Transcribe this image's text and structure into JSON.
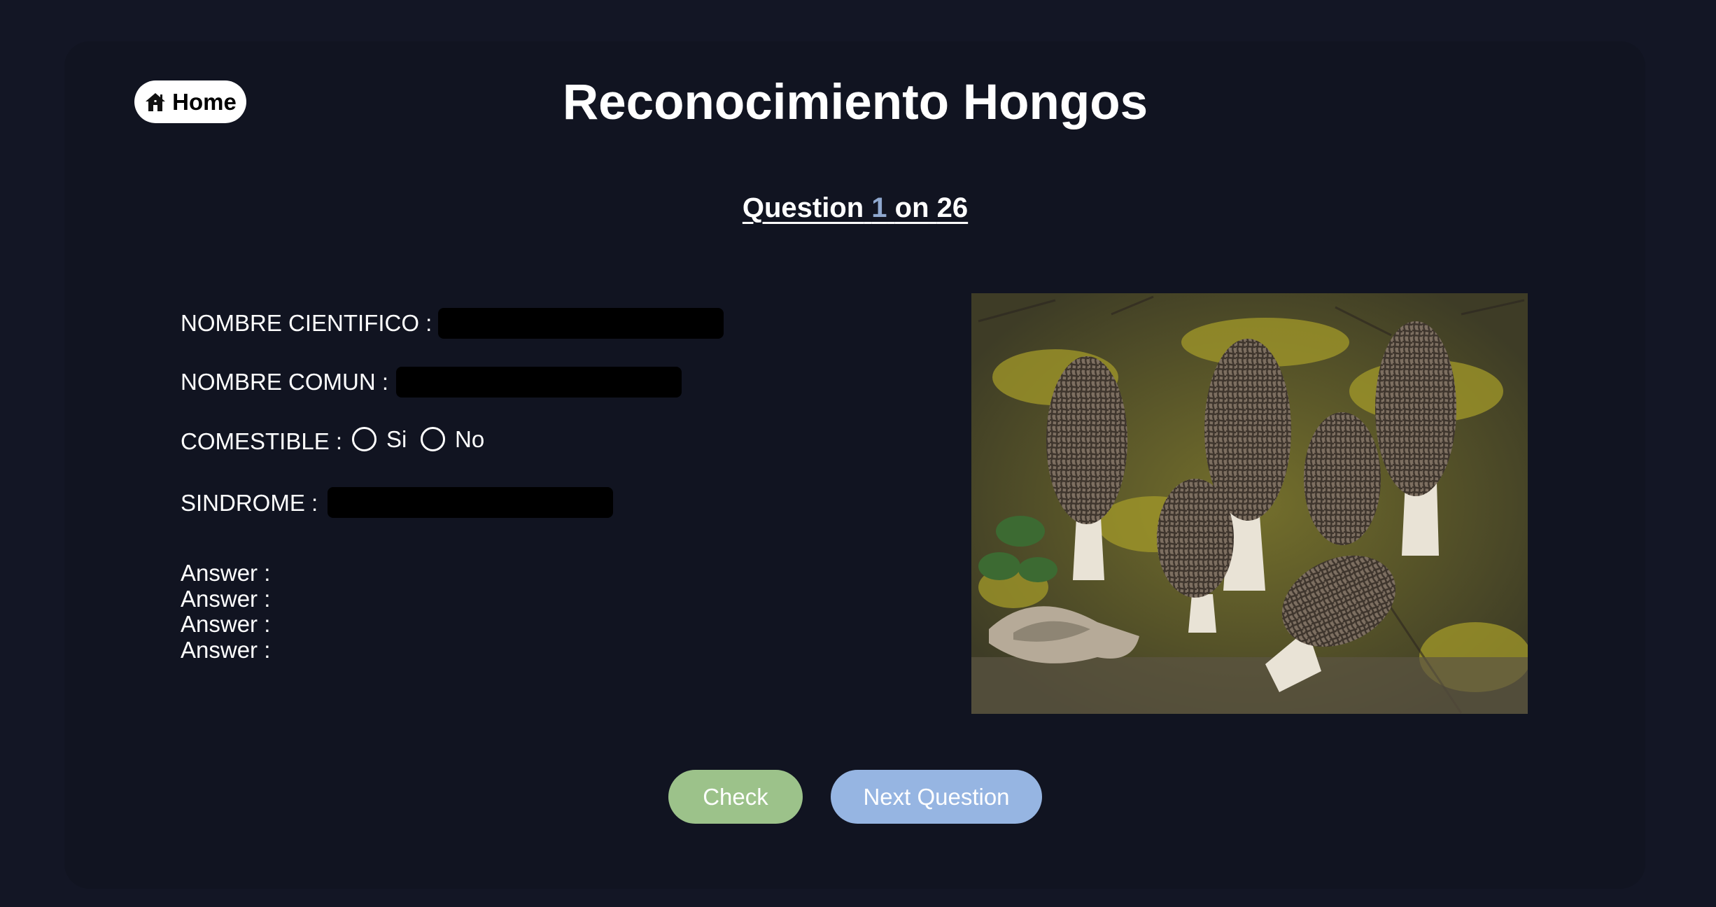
{
  "header": {
    "home_label": "Home",
    "title": "Reconocimiento Hongos"
  },
  "question": {
    "prefix": "Question",
    "current": "1",
    "separator": "on",
    "total": "26"
  },
  "form": {
    "scientific_name_label": "NOMBRE CIENTIFICO :",
    "scientific_name_value": "",
    "common_name_label": "NOMBRE COMUN :",
    "common_name_value": "",
    "edible_label": "COMESTIBLE :",
    "edible_options": [
      "Si",
      "No"
    ],
    "syndrome_label": "SINDROME :",
    "syndrome_value": ""
  },
  "answers": [
    "Answer :",
    "Answer :",
    "Answer :",
    "Answer :"
  ],
  "actions": {
    "check_label": "Check",
    "next_label": "Next Question"
  },
  "icons": {
    "home": "house-icon"
  },
  "colors": {
    "background": "#131625",
    "card": "#111421",
    "accent_number": "#8fa8cf",
    "check_button": "#9cc28a",
    "next_button": "#96b5e2"
  }
}
